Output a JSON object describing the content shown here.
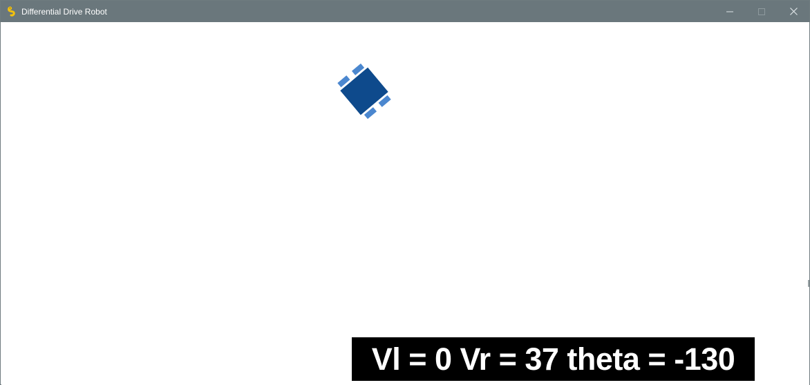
{
  "window": {
    "title": "Differential Drive Robot",
    "icon": "pygame-snake-icon",
    "controls": {
      "minimize_icon": "minimize-icon",
      "maximize_icon": "maximize-icon",
      "close_icon": "close-icon"
    },
    "titlebar_color": "#6a777c"
  },
  "simulation": {
    "robot_body_color": "#0e4a8c",
    "robot_wheel_color": "#4b87cf",
    "readout_text": "Vl = 0 Vr = 37 theta = -130",
    "Vl": 0,
    "Vr": 37,
    "theta": -130
  }
}
